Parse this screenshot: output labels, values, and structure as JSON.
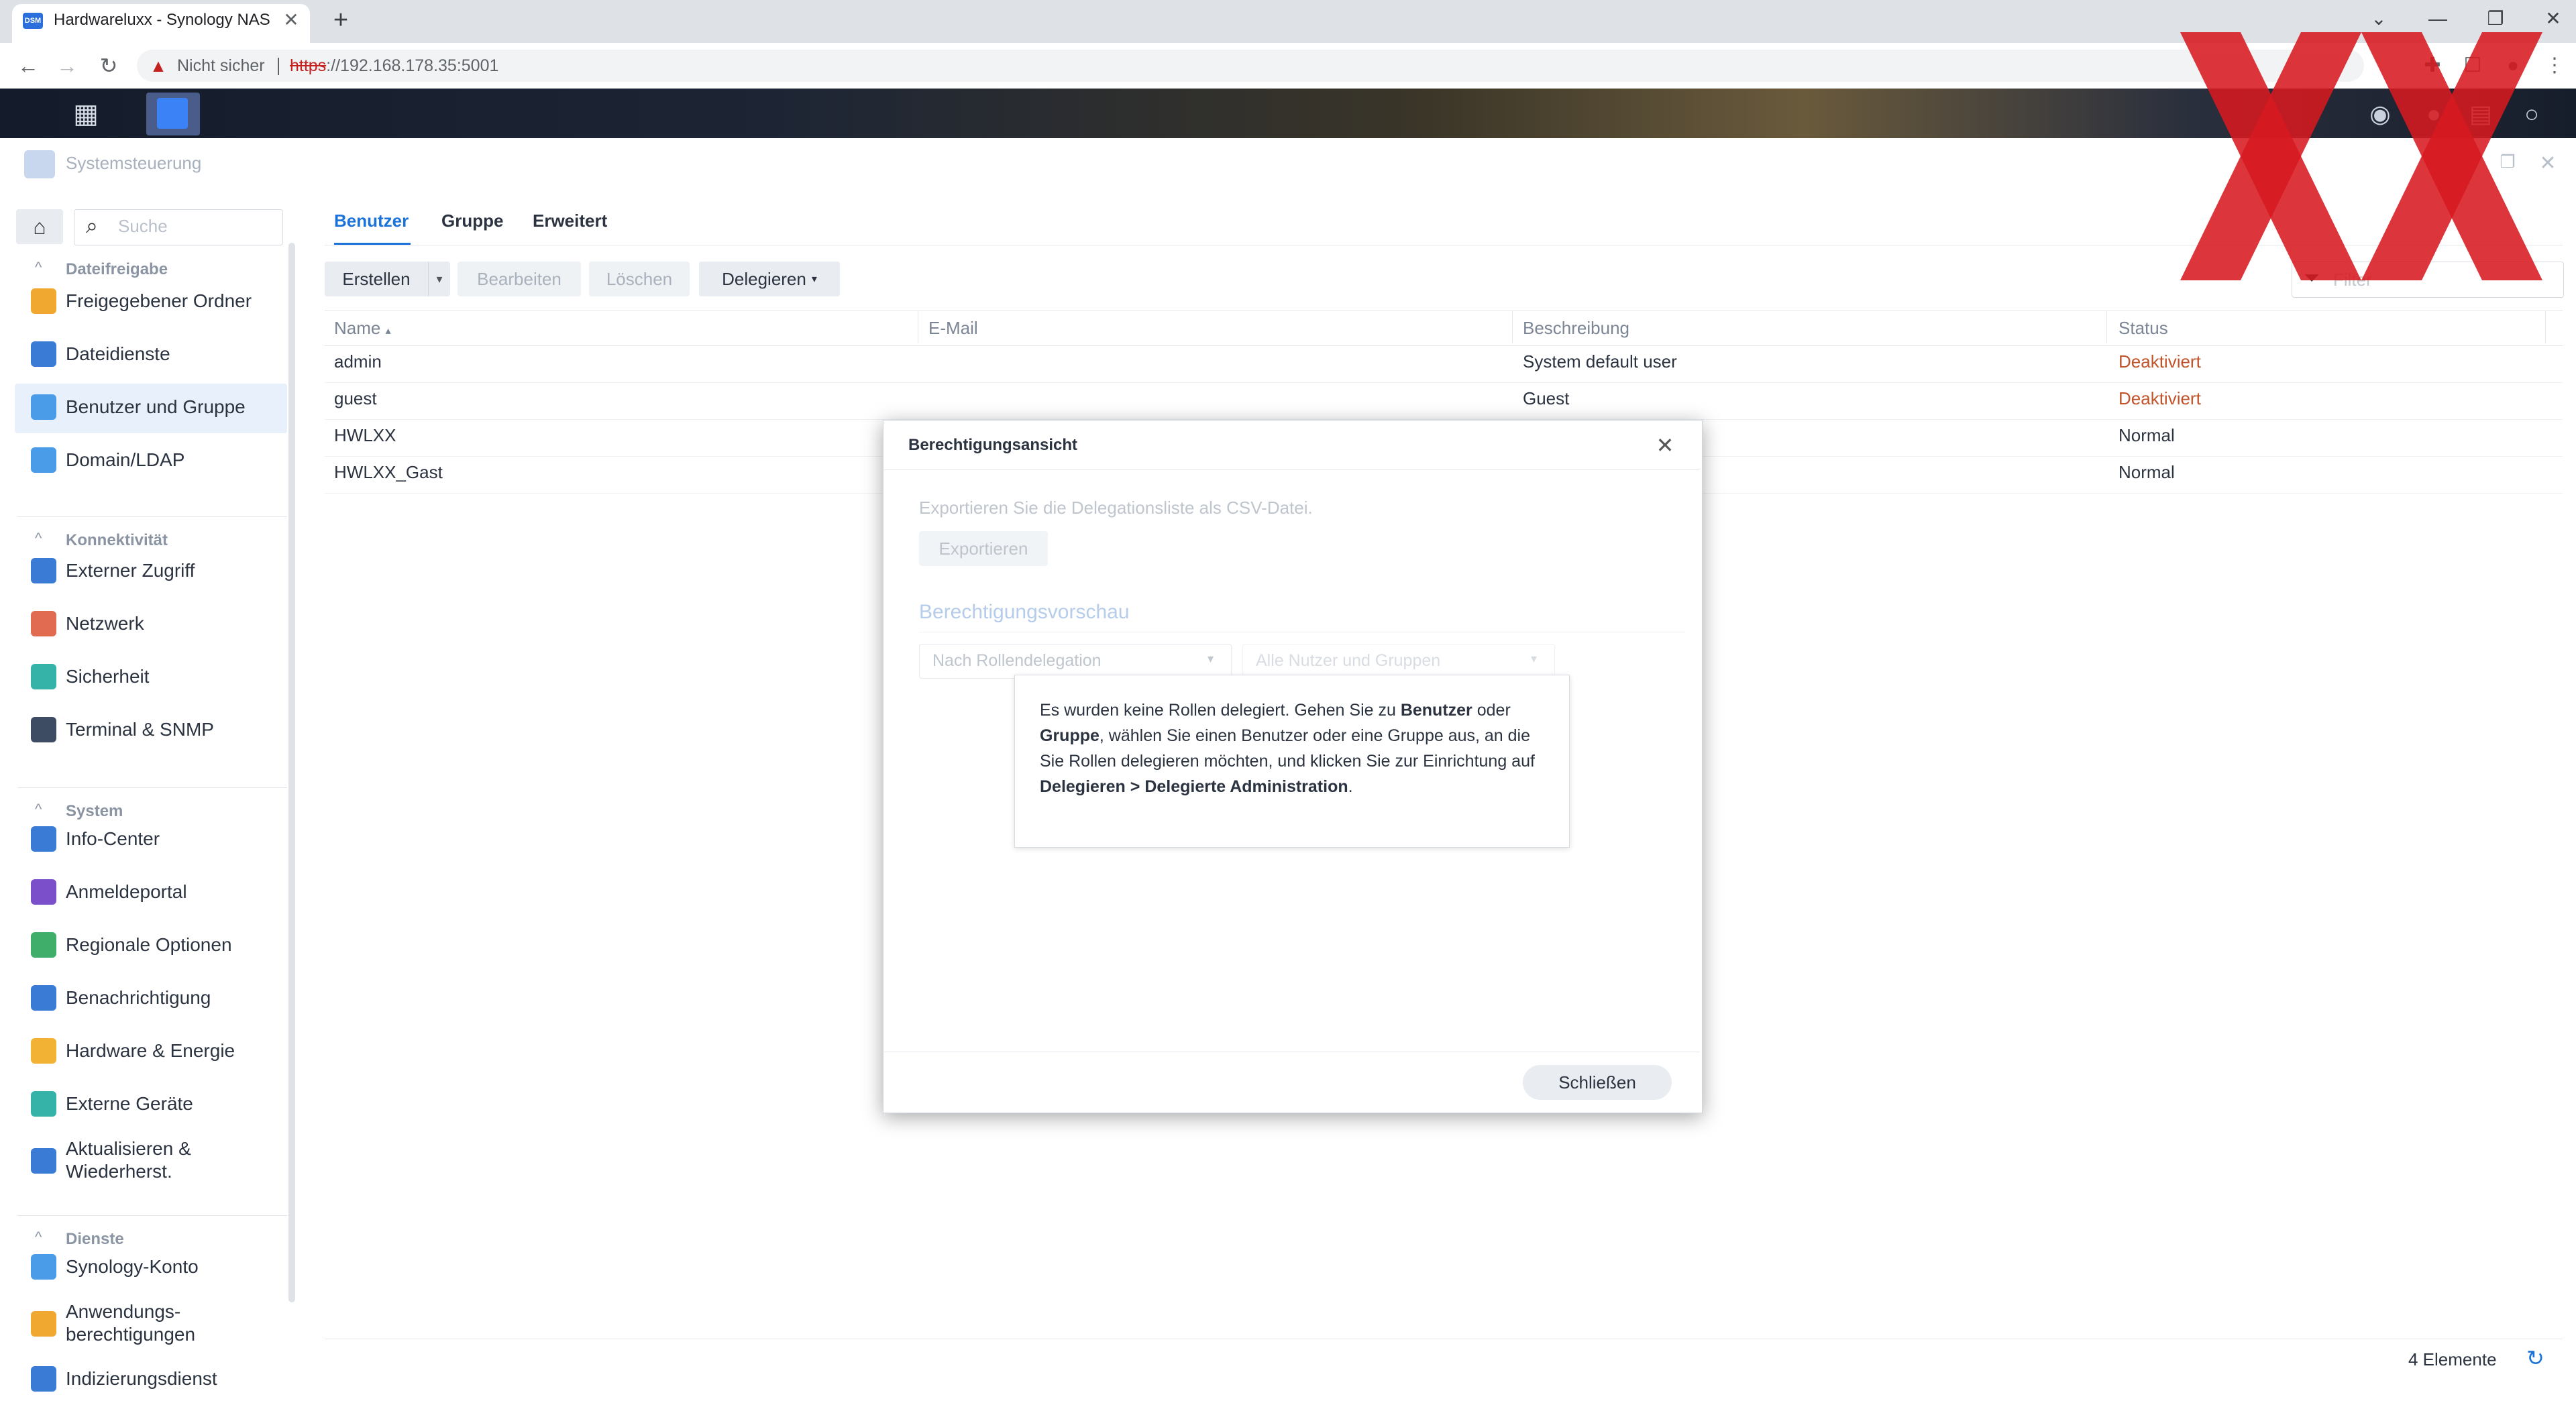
{
  "browser": {
    "tab_title": "Hardwareluxx - Synology NAS",
    "favicon_text": "DSM",
    "close_glyph": "✕",
    "newtab_glyph": "+",
    "not_secure": "Nicht sicher",
    "url_scheme": "https",
    "url_rest": "://192.168.178.35:5001"
  },
  "dsm": {
    "window_title": "Systemsteuerung"
  },
  "sidebar": {
    "search_placeholder": "Suche",
    "sections": [
      {
        "title": "Dateifreigabe",
        "items": [
          {
            "label": "Freigegebener Ordner",
            "icon": "folder-share-icon",
            "color": "#f0a830"
          },
          {
            "label": "Dateidienste",
            "icon": "file-services-icon",
            "color": "#3a7bd5"
          },
          {
            "label": "Benutzer und Gruppe",
            "icon": "users-icon",
            "color": "#4a9be8",
            "active": true
          },
          {
            "label": "Domain/LDAP",
            "icon": "domain-ldap-icon",
            "color": "#4a9be8"
          }
        ]
      },
      {
        "title": "Konnektivität",
        "items": [
          {
            "label": "Externer Zugriff",
            "icon": "external-access-icon",
            "color": "#3a7bd5"
          },
          {
            "label": "Netzwerk",
            "icon": "network-icon",
            "color": "#e06b50"
          },
          {
            "label": "Sicherheit",
            "icon": "shield-icon",
            "color": "#36b3a8"
          },
          {
            "label": "Terminal & SNMP",
            "icon": "terminal-icon",
            "color": "#3d4c63"
          }
        ]
      },
      {
        "title": "System",
        "items": [
          {
            "label": "Info-Center",
            "icon": "info-icon",
            "color": "#3a7bd5"
          },
          {
            "label": "Anmeldeportal",
            "icon": "login-portal-icon",
            "color": "#7a4fc9"
          },
          {
            "label": "Regionale Optionen",
            "icon": "regional-options-icon",
            "color": "#3fae6a"
          },
          {
            "label": "Benachrichtigung",
            "icon": "notification-icon",
            "color": "#3a7bd5"
          },
          {
            "label": "Hardware & Energie",
            "icon": "bulb-icon",
            "color": "#f2b233"
          },
          {
            "label": "Externe Geräte",
            "icon": "external-devices-icon",
            "color": "#36b3a8"
          },
          {
            "label": "Aktualisieren & Wiederherst.",
            "icon": "update-restore-icon",
            "color": "#3a7bd5"
          }
        ]
      },
      {
        "title": "Dienste",
        "items": [
          {
            "label": "Synology-Konto",
            "icon": "synology-account-icon",
            "color": "#4a9be8"
          },
          {
            "label": "Anwendungs-berechtigungen",
            "icon": "lock-icon",
            "color": "#f0a830"
          },
          {
            "label": "Indizierungsdienst",
            "icon": "indexing-icon",
            "color": "#3a7bd5"
          }
        ]
      }
    ]
  },
  "main": {
    "tabs": [
      "Benutzer",
      "Gruppe",
      "Erweitert"
    ],
    "active_tab": "Benutzer",
    "buttons": {
      "create": "Erstellen",
      "edit": "Bearbeiten",
      "delete": "Löschen",
      "delegate": "Delegieren"
    },
    "filter_placeholder": "Filter",
    "table": {
      "columns": [
        "Name",
        "E-Mail",
        "Beschreibung",
        "Status"
      ],
      "rows": [
        {
          "name": "admin",
          "email": "",
          "description": "System default user",
          "status": "Deaktiviert"
        },
        {
          "name": "guest",
          "email": "",
          "description": "Guest",
          "status": "Deaktiviert"
        },
        {
          "name": "HWLXX",
          "email": "",
          "description": "",
          "status": "Normal"
        },
        {
          "name": "HWLXX_Gast",
          "email": "",
          "description": "",
          "status": "Normal"
        }
      ]
    },
    "footer_count": "4 Elemente"
  },
  "dialog": {
    "title": "Berechtigungsansicht",
    "export_text": "Exportieren Sie die Delegationsliste als CSV-Datei.",
    "export_button": "Exportieren",
    "section_title": "Berechtigungsvorschau",
    "select_role": "Nach Rollendelegation",
    "select_scope": "Alle Nutzer und Gruppen",
    "msg_part1": "Es wurden keine Rollen delegiert. Gehen Sie zu ",
    "msg_bold1": "Benutzer",
    "msg_part2": " oder ",
    "msg_bold2": "Gruppe",
    "msg_part3": ", wählen Sie einen Benutzer oder eine Gruppe aus, an die Sie Rollen delegieren möchten, und klicken Sie zur Einrichtung auf ",
    "msg_bold3": "Delegieren > Delegierte Administration",
    "msg_part4": ".",
    "close_button": "Schließen"
  },
  "colors": {
    "accent": "#1b72d8",
    "status_disabled": "#c0542a",
    "logo_red": "#d71920"
  }
}
